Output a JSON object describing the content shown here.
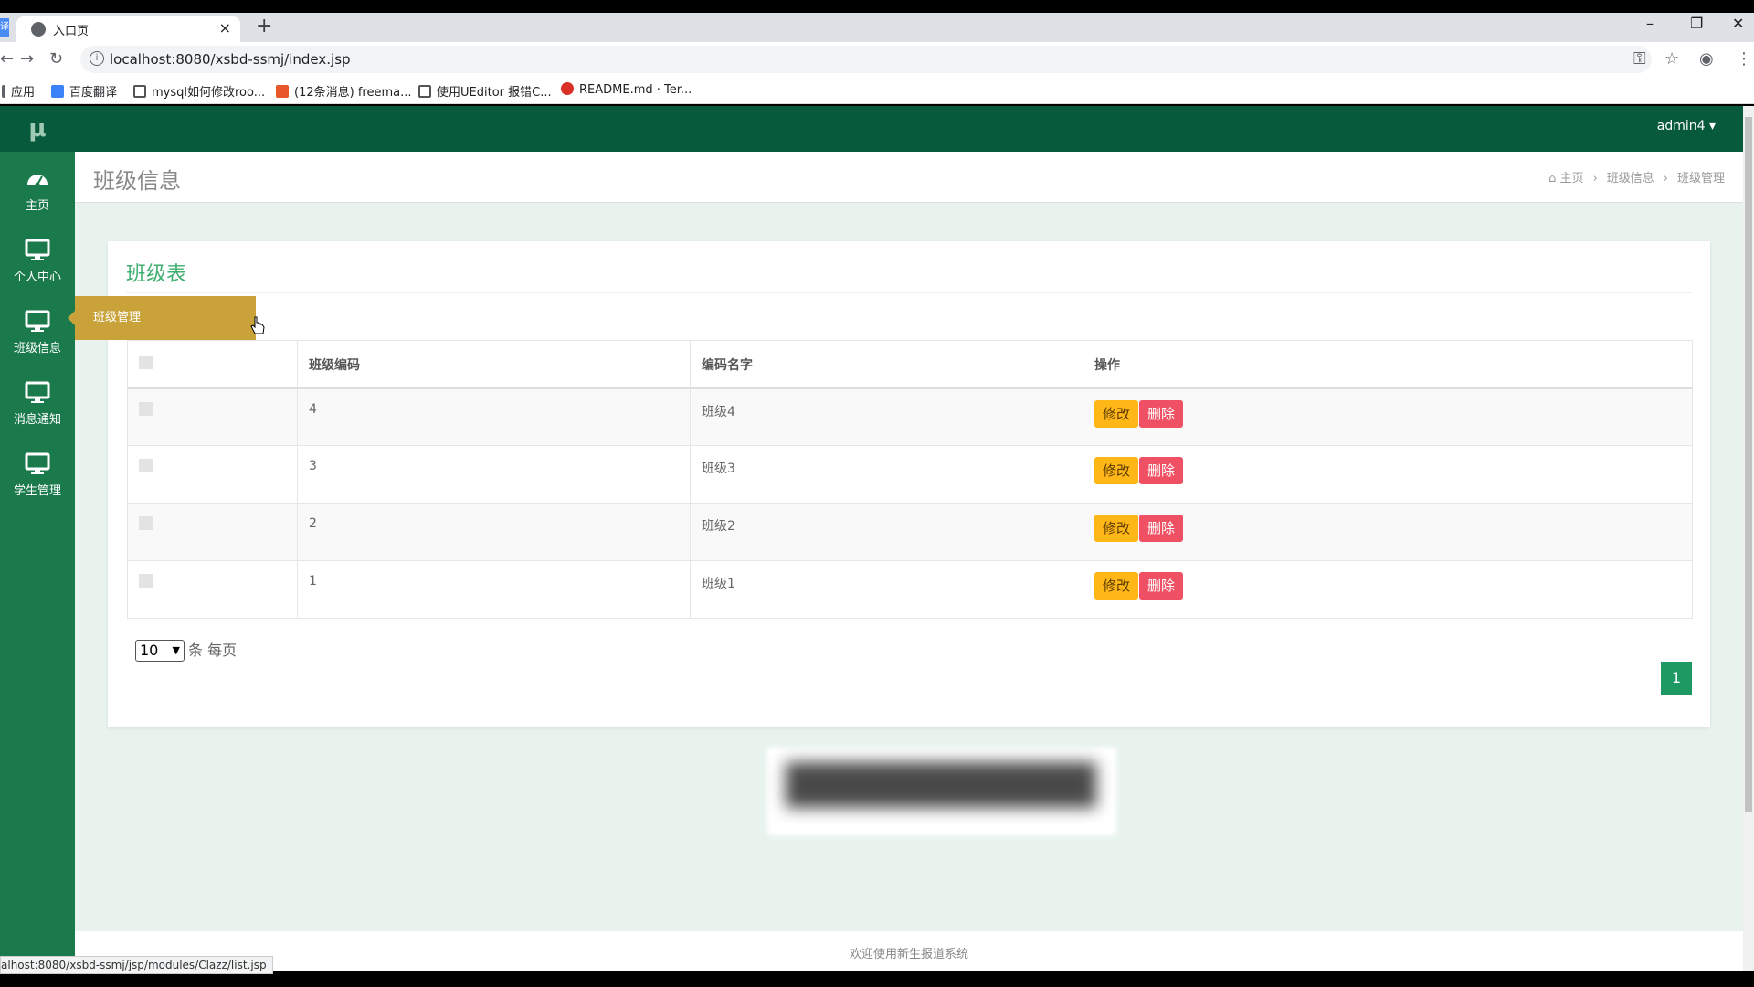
{
  "browser": {
    "tab_title": "入口页",
    "tab_close": "×",
    "new_tab": "+",
    "side_tab_glyph": "译",
    "url": "localhost:8080/xsbd-ssmj/index.jsp",
    "bookmarks": [
      {
        "label": "应用",
        "icon_color": "#5f6368"
      },
      {
        "label": "百度翻译",
        "icon_color": "#3b82f6"
      },
      {
        "label": "mysql如何修改roo...",
        "icon_color": "#555555"
      },
      {
        "label": "(12条消息) freema...",
        "icon_color": "#e8572a"
      },
      {
        "label": "使用UEditor 报错C...",
        "icon_color": "#555555"
      },
      {
        "label": "README.md · Ter...",
        "icon_color": "#d93025"
      }
    ],
    "status_url": "alhost:8080/xsbd-ssmj/jsp/modules/Clazz/list.jsp"
  },
  "app": {
    "logo": "μ",
    "user": "admin4 ▾",
    "sidebar": [
      {
        "label": "主页",
        "icon": "dashboard-icon"
      },
      {
        "label": "个人中心",
        "icon": "monitor-icon"
      },
      {
        "label": "班级信息",
        "icon": "monitor-icon"
      },
      {
        "label": "消息通知",
        "icon": "monitor-icon"
      },
      {
        "label": "学生管理",
        "icon": "monitor-icon"
      }
    ],
    "flyout_item": "班级管理",
    "page_title": "班级信息",
    "breadcrumb": [
      "主页",
      "班级信息",
      "班级管理"
    ],
    "card_title": "班级表",
    "table": {
      "headers": [
        "",
        "班级编码",
        "编码名字",
        "操作"
      ],
      "rows": [
        {
          "code": "4",
          "name": "班级4"
        },
        {
          "code": "3",
          "name": "班级3"
        },
        {
          "code": "2",
          "name": "班级2"
        },
        {
          "code": "1",
          "name": "班级1"
        }
      ],
      "edit_label": "修改",
      "delete_label": "删除"
    },
    "pager": {
      "page_size": "10",
      "per_page_label": "条 每页",
      "current_page": "1"
    },
    "footer": "欢迎使用新生报道系统"
  },
  "colors": {
    "sidebar": "#1b7a4c",
    "topbar": "#085a3c",
    "accent_title": "#3fae6e",
    "flyout": "#c9a33a",
    "edit_btn": "#ffb717",
    "delete_btn": "#f05063",
    "page_btn": "#1e9963"
  }
}
